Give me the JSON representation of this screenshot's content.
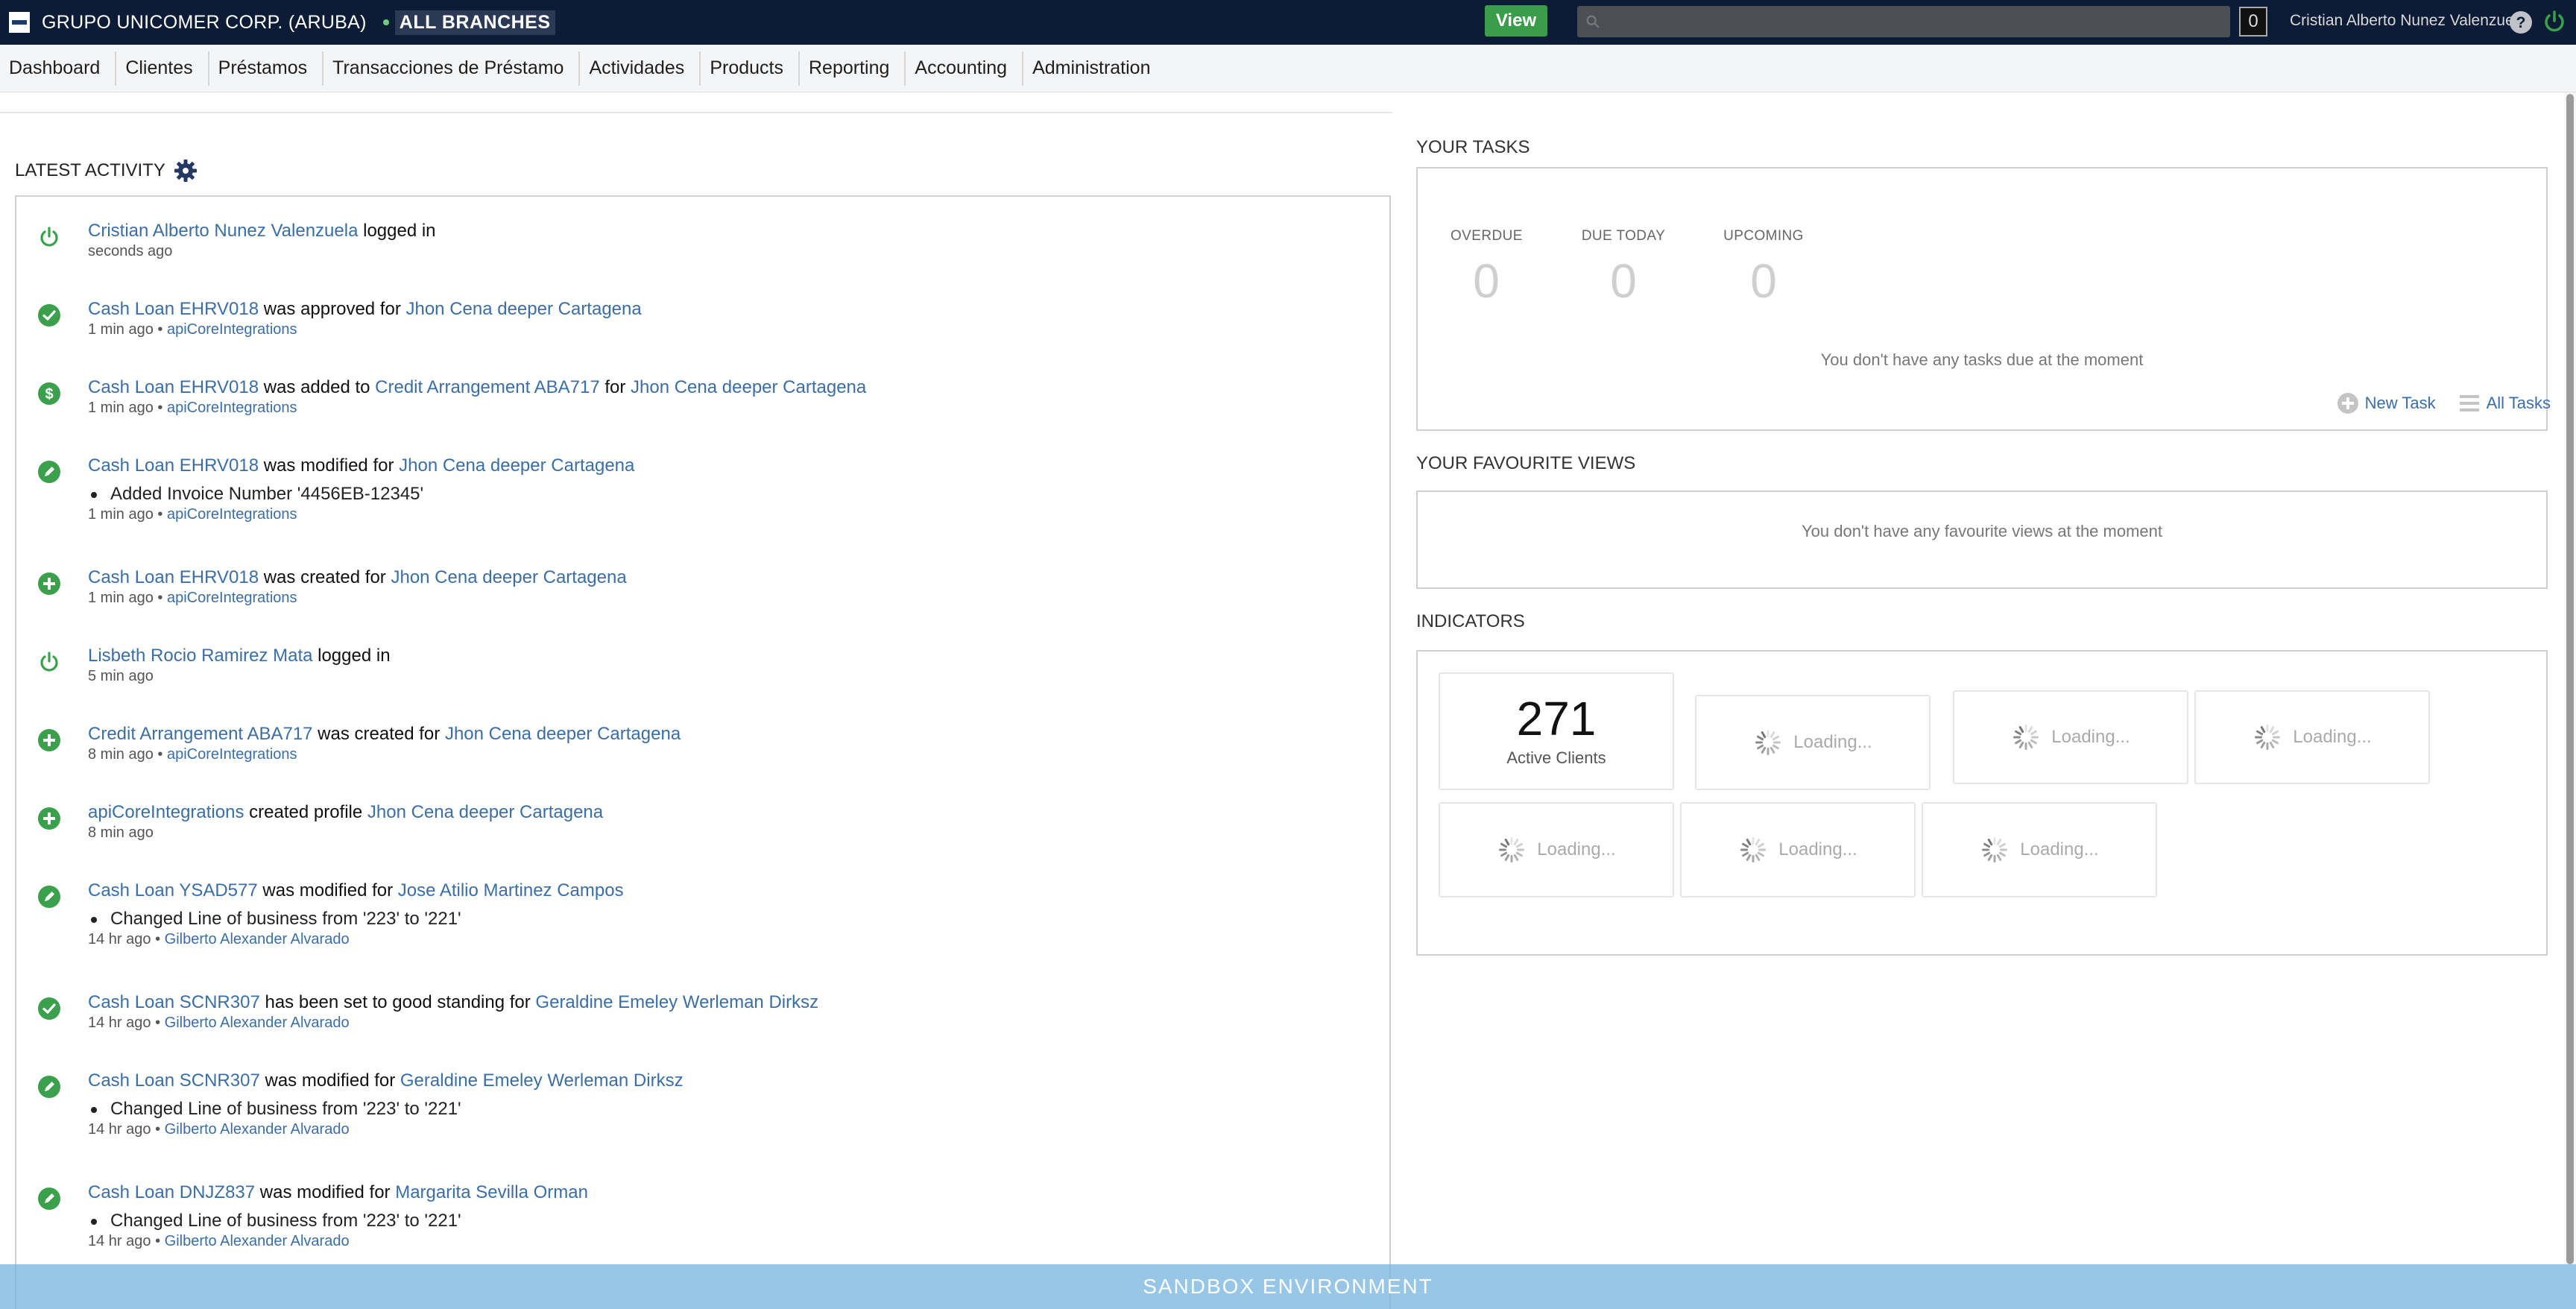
{
  "topbar": {
    "org_name": "GRUPO UNICOMER CORP. (ARUBA)",
    "branch_label": "ALL BRANCHES",
    "view_button": "View",
    "search_placeholder": "",
    "notification_count": "0",
    "user_name": "Cristian Alberto Nunez Valenzuela"
  },
  "nav": {
    "items": [
      {
        "label": "Dashboard"
      },
      {
        "label": "Clientes"
      },
      {
        "label": "Préstamos"
      },
      {
        "label": "Transacciones  de  Préstamo"
      },
      {
        "label": "Actividades"
      },
      {
        "label": "Products"
      },
      {
        "label": "Reporting"
      },
      {
        "label": "Accounting"
      },
      {
        "label": "Administration"
      }
    ]
  },
  "latest_activity": {
    "title": "LATEST ACTIVITY",
    "items": [
      {
        "icon": "power-icon",
        "color": "#3aa04c",
        "parts": [
          {
            "t": "Cristian Alberto Nunez Valenzuela",
            "link": true
          },
          {
            "t": " logged in",
            "link": false
          }
        ],
        "detail": "",
        "time": "seconds ago",
        "by": ""
      },
      {
        "icon": "check-icon",
        "color": "#3aa04c",
        "parts": [
          {
            "t": "Cash Loan EHRV018",
            "link": true
          },
          {
            "t": " was approved for ",
            "link": false
          },
          {
            "t": "Jhon Cena deeper Cartagena",
            "link": true
          }
        ],
        "detail": "",
        "time": "1 min ago",
        "by": "apiCoreIntegrations"
      },
      {
        "icon": "dollar-icon",
        "color": "#3aa04c",
        "parts": [
          {
            "t": "Cash Loan EHRV018",
            "link": true
          },
          {
            "t": " was added to ",
            "link": false
          },
          {
            "t": "Credit Arrangement ABA717",
            "link": true
          },
          {
            "t": " for ",
            "link": false
          },
          {
            "t": "Jhon Cena deeper Cartagena",
            "link": true
          }
        ],
        "detail": "",
        "time": "1 min ago",
        "by": "apiCoreIntegrations"
      },
      {
        "icon": "pencil-icon",
        "color": "#3aa04c",
        "parts": [
          {
            "t": "Cash Loan EHRV018",
            "link": true
          },
          {
            "t": " was modified for ",
            "link": false
          },
          {
            "t": "Jhon Cena deeper Cartagena",
            "link": true
          }
        ],
        "detail": "Added Invoice Number '4456EB-12345'",
        "time": "1 min ago",
        "by": "apiCoreIntegrations"
      },
      {
        "icon": "plus-icon",
        "color": "#3aa04c",
        "parts": [
          {
            "t": "Cash Loan EHRV018",
            "link": true
          },
          {
            "t": " was created for ",
            "link": false
          },
          {
            "t": "Jhon Cena deeper Cartagena",
            "link": true
          }
        ],
        "detail": "",
        "time": "1 min ago",
        "by": "apiCoreIntegrations"
      },
      {
        "icon": "power-icon",
        "color": "#3aa04c",
        "parts": [
          {
            "t": "Lisbeth Rocio Ramirez Mata",
            "link": true
          },
          {
            "t": " logged in",
            "link": false
          }
        ],
        "detail": "",
        "time": "5 min ago",
        "by": ""
      },
      {
        "icon": "plus-icon",
        "color": "#3aa04c",
        "parts": [
          {
            "t": "Credit Arrangement ABA717",
            "link": true
          },
          {
            "t": " was created for ",
            "link": false
          },
          {
            "t": "Jhon Cena deeper Cartagena",
            "link": true
          }
        ],
        "detail": "",
        "time": "8 min ago",
        "by": "apiCoreIntegrations"
      },
      {
        "icon": "plus-icon",
        "color": "#3aa04c",
        "parts": [
          {
            "t": "apiCoreIntegrations",
            "link": true
          },
          {
            "t": " created profile ",
            "link": false
          },
          {
            "t": "Jhon Cena deeper Cartagena",
            "link": true
          }
        ],
        "detail": "",
        "time": "8 min ago",
        "by": ""
      },
      {
        "icon": "pencil-icon",
        "color": "#3aa04c",
        "parts": [
          {
            "t": "Cash Loan YSAD577",
            "link": true
          },
          {
            "t": " was modified for ",
            "link": false
          },
          {
            "t": "Jose Atilio Martinez Campos",
            "link": true
          }
        ],
        "detail": "Changed Line of business from '223' to '221'",
        "time": "14 hr ago",
        "by": "Gilberto Alexander Alvarado"
      },
      {
        "icon": "check-icon",
        "color": "#3aa04c",
        "parts": [
          {
            "t": "Cash Loan SCNR307",
            "link": true
          },
          {
            "t": " has been set to good standing for ",
            "link": false
          },
          {
            "t": "Geraldine Emeley Werleman Dirksz",
            "link": true
          }
        ],
        "detail": "",
        "time": "14 hr ago",
        "by": "Gilberto Alexander Alvarado"
      },
      {
        "icon": "pencil-icon",
        "color": "#3aa04c",
        "parts": [
          {
            "t": "Cash Loan SCNR307",
            "link": true
          },
          {
            "t": " was modified for ",
            "link": false
          },
          {
            "t": "Geraldine Emeley Werleman Dirksz",
            "link": true
          }
        ],
        "detail": "Changed Line of business from '223' to '221'",
        "time": "14 hr ago",
        "by": "Gilberto Alexander Alvarado"
      },
      {
        "icon": "pencil-icon",
        "color": "#3aa04c",
        "parts": [
          {
            "t": "Cash Loan DNJZ837",
            "link": true
          },
          {
            "t": " was modified for ",
            "link": false
          },
          {
            "t": "Margarita Sevilla Orman",
            "link": true
          }
        ],
        "detail": "Changed Line of business from '223' to '221'",
        "time": "14 hr ago",
        "by": "Gilberto Alexander Alvarado"
      }
    ]
  },
  "tasks": {
    "title": "YOUR TASKS",
    "overdue_label": "OVERDUE",
    "overdue_value": "0",
    "due_today_label": "DUE TODAY",
    "due_today_value": "0",
    "upcoming_label": "UPCOMING",
    "upcoming_value": "0",
    "empty_message": "You don't have any tasks due at the moment",
    "new_task": "New Task",
    "all_tasks": "All Tasks"
  },
  "favourites": {
    "title": "YOUR FAVOURITE VIEWS",
    "empty_message": "You don't have any favourite views at the moment"
  },
  "indicators": {
    "title": "INDICATORS",
    "active_clients_value": "271",
    "active_clients_label": "Active Clients",
    "loading_label": "Loading..."
  },
  "footer": {
    "sandbox_label": "SANDBOX ENVIRONMENT"
  },
  "colors": {
    "topbar_bg": "#0d1c36",
    "link": "#3b6ea5",
    "success_green": "#3aa04c",
    "sandbox_bar": "#70b0de"
  }
}
